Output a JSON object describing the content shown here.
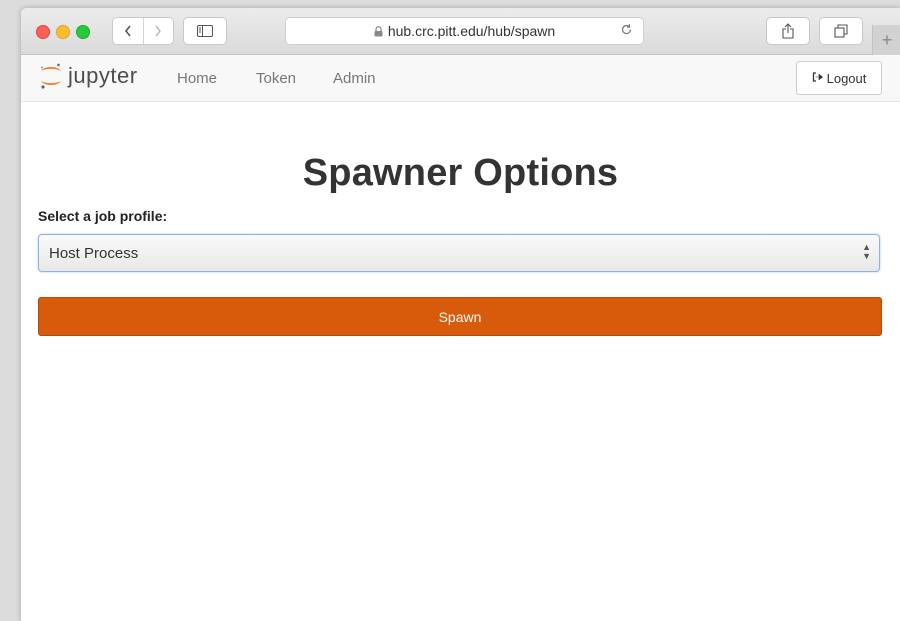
{
  "browser": {
    "url": "hub.crc.pitt.edu/hub/spawn",
    "new_tab": "+"
  },
  "navbar": {
    "logo_text": "jupyter",
    "links": [
      "Home",
      "Token",
      "Admin"
    ],
    "logout_label": "Logout"
  },
  "main": {
    "title": "Spawner Options",
    "profile_label": "Select a job profile:",
    "profile_selected": "Host Process",
    "spawn_label": "Spawn"
  },
  "colors": {
    "accent": "#d85b0c",
    "logo_orange": "#f37726"
  }
}
